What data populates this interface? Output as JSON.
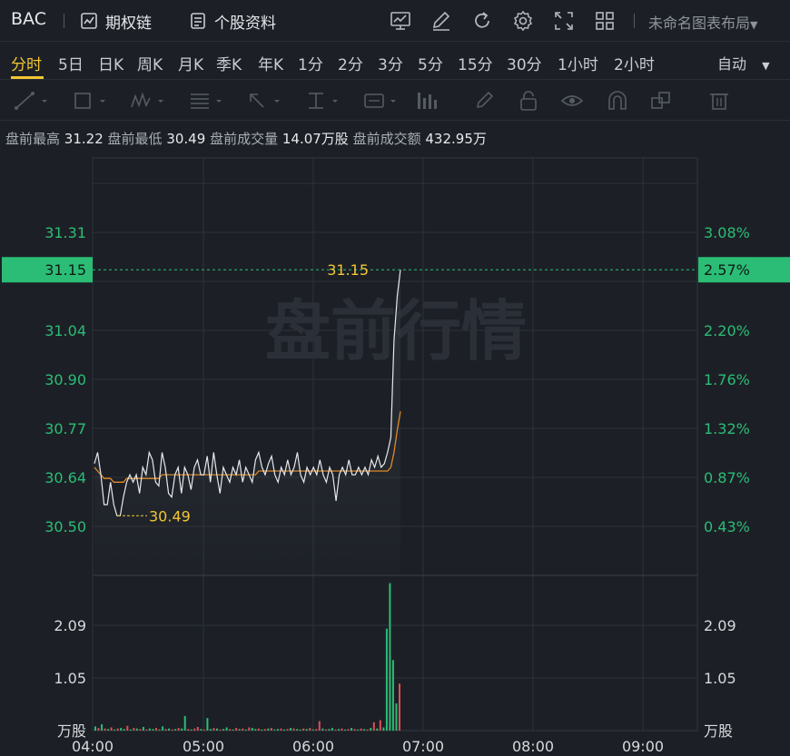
{
  "header": {
    "symbol": "BAC",
    "options_chain": "期权链",
    "stock_info": "个股资料",
    "layout_name": "未命名图表布局"
  },
  "periods": [
    "分时",
    "5日",
    "日K",
    "周K",
    "月K",
    "季K",
    "年K",
    "1分",
    "2分",
    "3分",
    "5分",
    "15分",
    "30分",
    "1小时",
    "2小时"
  ],
  "period_auto": "自动",
  "premarket": {
    "high_label": "盘前最高",
    "high": "31.22",
    "low_label": "盘前最低",
    "low": "30.49",
    "vol_label": "盘前成交量",
    "vol": "14.07万股",
    "amt_label": "盘前成交额",
    "amt": "432.95万"
  },
  "watermark": "盘前行情",
  "colors": {
    "up": "#2bbd76",
    "down": "#e14d56",
    "price": "#e6e8eb",
    "avg": "#e08a28",
    "accent": "#f2c633"
  },
  "chart_data": {
    "type": "line",
    "x_ticks": [
      "04:00",
      "05:00",
      "06:00",
      "07:00",
      "08:00",
      "09:00"
    ],
    "price_ticks": [
      "31.31",
      "31.04",
      "30.90",
      "30.77",
      "30.64",
      "30.50"
    ],
    "pct_ticks": [
      "3.08%",
      "2.20%",
      "1.76%",
      "1.32%",
      "0.87%",
      "0.43%"
    ],
    "current_price": "31.15",
    "current_pct": "2.57%",
    "max_label": "31.15",
    "min_label": "30.49",
    "vol_ticks": [
      "2.09",
      "1.05"
    ],
    "vol_unit": "万股",
    "price_ylim": [
      30.33,
      31.45
    ],
    "vol_ylim": [
      0,
      2.9
    ],
    "series": [
      {
        "values": [
          30.63,
          30.66,
          30.6,
          30.52,
          30.52,
          30.58,
          30.52,
          30.49,
          30.49,
          30.54,
          30.58,
          30.6,
          30.58,
          30.6,
          30.55,
          30.62,
          30.6,
          30.66,
          30.64,
          30.58,
          30.57,
          30.66,
          30.62,
          30.55,
          30.54,
          30.6,
          30.62,
          30.55,
          30.62,
          30.6,
          30.56,
          30.62,
          30.64,
          30.6,
          30.6,
          30.65,
          30.58,
          30.66,
          30.6,
          30.55,
          30.62,
          30.6,
          30.58,
          30.62,
          30.6,
          30.64,
          30.58,
          30.62,
          30.6,
          30.58,
          30.64,
          30.66,
          30.62,
          30.6,
          30.63,
          30.65,
          30.6,
          30.58,
          30.62,
          30.6,
          30.64,
          30.6,
          30.62,
          30.66,
          30.6,
          30.58,
          30.62,
          30.6,
          30.62,
          30.6,
          30.64,
          30.6,
          30.58,
          30.62,
          30.6,
          30.53,
          30.6,
          30.62,
          30.6,
          30.64,
          30.6,
          30.6,
          30.62,
          30.6,
          30.62,
          30.6,
          30.64,
          30.62,
          30.65,
          30.62,
          30.63,
          30.66,
          30.7,
          30.96,
          31.08,
          31.15
        ]
      },
      {
        "values": [
          30.62,
          30.61,
          30.6,
          30.59,
          30.59,
          30.59,
          30.58,
          30.58,
          30.58,
          30.58,
          30.59,
          30.59,
          30.59,
          30.59,
          30.59,
          30.59,
          30.59,
          30.59,
          30.59,
          30.59,
          30.59,
          30.6,
          30.6,
          30.6,
          30.6,
          30.6,
          30.6,
          30.6,
          30.6,
          30.6,
          30.6,
          30.6,
          30.6,
          30.6,
          30.6,
          30.6,
          30.6,
          30.6,
          30.6,
          30.6,
          30.6,
          30.6,
          30.6,
          30.6,
          30.6,
          30.6,
          30.6,
          30.6,
          30.6,
          30.6,
          30.6,
          30.61,
          30.61,
          30.61,
          30.61,
          30.61,
          30.61,
          30.61,
          30.61,
          30.61,
          30.61,
          30.61,
          30.61,
          30.61,
          30.61,
          30.61,
          30.61,
          30.61,
          30.61,
          30.61,
          30.61,
          30.61,
          30.61,
          30.61,
          30.61,
          30.61,
          30.61,
          30.61,
          30.61,
          30.61,
          30.61,
          30.61,
          30.61,
          30.61,
          30.61,
          30.61,
          30.61,
          30.61,
          30.61,
          30.61,
          30.61,
          30.61,
          30.62,
          30.66,
          30.72,
          30.77
        ]
      }
    ],
    "volume": [
      0.08,
      0.05,
      0.12,
      0.04,
      0.03,
      0.06,
      0.02,
      0.04,
      0.05,
      0.03,
      0.09,
      0.02,
      0.05,
      0.04,
      0.03,
      0.07,
      0.02,
      0.04,
      0.03,
      0.05,
      0.02,
      0.08,
      0.03,
      0.04,
      0.02,
      0.03,
      0.05,
      0.04,
      0.28,
      0.03,
      0.02,
      0.04,
      0.07,
      0.03,
      0.02,
      0.24,
      0.03,
      0.05,
      0.04,
      0.02,
      0.03,
      0.06,
      0.03,
      0.02,
      0.05,
      0.03,
      0.04,
      0.02,
      0.06,
      0.05,
      0.03,
      0.04,
      0.02,
      0.03,
      0.04,
      0.05,
      0.02,
      0.03,
      0.04,
      0.02,
      0.03,
      0.05,
      0.04,
      0.03,
      0.02,
      0.04,
      0.03,
      0.05,
      0.02,
      0.03,
      0.18,
      0.04,
      0.02,
      0.03,
      0.05,
      0.02,
      0.03,
      0.04,
      0.02,
      0.03,
      0.05,
      0.03,
      0.02,
      0.04,
      0.03,
      0.02,
      0.05,
      0.16,
      0.04,
      0.2,
      0.06,
      1.95,
      2.82,
      1.35,
      0.52,
      0.9
    ],
    "volume_up": [
      1,
      0,
      1,
      0,
      1,
      0,
      1,
      0,
      1,
      1,
      0,
      1,
      0,
      1,
      0,
      1,
      0,
      1,
      1,
      0,
      1,
      1,
      0,
      1,
      0,
      1,
      0,
      1,
      1,
      0,
      1,
      0,
      0,
      1,
      0,
      1,
      1,
      0,
      1,
      0,
      1,
      1,
      0,
      1,
      0,
      1,
      0,
      1,
      0,
      1,
      1,
      0,
      1,
      0,
      1,
      0,
      1,
      1,
      0,
      1,
      0,
      1,
      0,
      1,
      1,
      0,
      1,
      0,
      1,
      0,
      0,
      1,
      0,
      1,
      1,
      0,
      1,
      0,
      1,
      0,
      1,
      0,
      1,
      0,
      1,
      0,
      1,
      0,
      1,
      0,
      1,
      1,
      1,
      1,
      1,
      0
    ]
  }
}
